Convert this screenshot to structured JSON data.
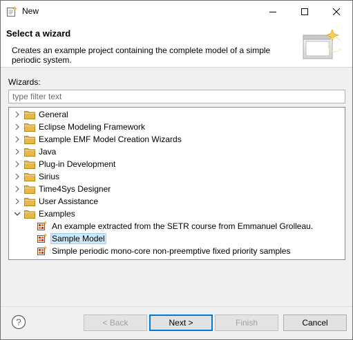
{
  "window": {
    "title": "New",
    "controls": {
      "minimize": "minimize",
      "maximize": "maximize",
      "close": "close"
    }
  },
  "banner": {
    "title": "Select a wizard",
    "description": "Creates an example project containing the complete model of a simple periodic system."
  },
  "wizards_label": "Wizards:",
  "filter": {
    "placeholder": "type filter text",
    "value": ""
  },
  "tree": {
    "categories": [
      {
        "label": "General",
        "expanded": false
      },
      {
        "label": "Eclipse Modeling Framework",
        "expanded": false
      },
      {
        "label": "Example EMF Model Creation Wizards",
        "expanded": false
      },
      {
        "label": "Java",
        "expanded": false
      },
      {
        "label": "Plug-in Development",
        "expanded": false
      },
      {
        "label": "Sirius",
        "expanded": false
      },
      {
        "label": "Time4Sys Designer",
        "expanded": false
      },
      {
        "label": "User Assistance",
        "expanded": false
      },
      {
        "label": "Examples",
        "expanded": true
      }
    ],
    "examples_children": [
      {
        "label": "An example extracted from the SETR course from Emmanuel Grolleau.",
        "selected": false
      },
      {
        "label": "Sample Model",
        "selected": true
      },
      {
        "label": "Simple periodic mono-core non-preemptive fixed priority samples",
        "selected": false
      }
    ]
  },
  "buttons": {
    "back": "< Back",
    "next": "Next >",
    "finish": "Finish",
    "cancel": "Cancel"
  },
  "icons": {
    "app": "new-wizard-icon",
    "help": "help-icon",
    "folder": "folder-icon",
    "wizard_item": "example-wizard-icon"
  },
  "colors": {
    "selection_bg": "#cce8ff",
    "selection_border": "#99d1ff",
    "default_button_border": "#0078d7",
    "folder": "#e8b84a"
  }
}
